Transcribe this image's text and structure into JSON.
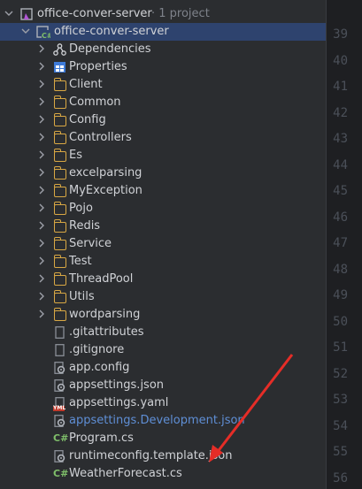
{
  "root": {
    "label": "office-conver-server",
    "suffix": "· 1 project"
  },
  "project": {
    "label": "office-conver-server"
  },
  "items": [
    {
      "label": "Dependencies",
      "icon": "dependencies-icon"
    },
    {
      "label": "Properties",
      "icon": "properties-icon"
    },
    {
      "label": "Client",
      "icon": "folder-icon"
    },
    {
      "label": "Common",
      "icon": "folder-icon"
    },
    {
      "label": "Config",
      "icon": "folder-icon"
    },
    {
      "label": "Controllers",
      "icon": "folder-icon"
    },
    {
      "label": "Es",
      "icon": "folder-icon"
    },
    {
      "label": "excelparsing",
      "icon": "folder-icon"
    },
    {
      "label": "MyException",
      "icon": "folder-icon"
    },
    {
      "label": "Pojo",
      "icon": "folder-icon"
    },
    {
      "label": "Redis",
      "icon": "folder-icon"
    },
    {
      "label": "Service",
      "icon": "folder-icon"
    },
    {
      "label": "Test",
      "icon": "folder-icon"
    },
    {
      "label": "ThreadPool",
      "icon": "folder-icon"
    },
    {
      "label": "Utils",
      "icon": "folder-icon"
    },
    {
      "label": "wordparsing",
      "icon": "folder-icon"
    }
  ],
  "files": [
    {
      "label": ".gitattributes",
      "icon": "file-icon"
    },
    {
      "label": ".gitignore",
      "icon": "file-icon"
    },
    {
      "label": "app.config",
      "icon": "config-file-icon"
    },
    {
      "label": "appsettings.json",
      "icon": "config-file-icon"
    },
    {
      "label": "appsettings.yaml",
      "icon": "yaml-file-icon",
      "badge": "YML"
    },
    {
      "label": "appsettings.Development.json",
      "icon": "config-file-icon"
    },
    {
      "label": "Program.cs",
      "icon": "csharp-file-icon",
      "badge": "C#"
    },
    {
      "label": "runtimeconfig.template.json",
      "icon": "config-file-icon"
    },
    {
      "label": "WeatherForecast.cs",
      "icon": "csharp-file-icon",
      "badge": "C#"
    }
  ],
  "project_badge": "C#",
  "line_numbers": [
    "39",
    "40",
    "41",
    "42",
    "43",
    "44",
    "45",
    "46",
    "47",
    "48",
    "49",
    "50",
    "51",
    "52",
    "53",
    "54",
    "55",
    "56"
  ],
  "colors": {
    "folder": "#d9a844",
    "selection": "#2e436e",
    "csharp": "#7fbf6a",
    "arrow": "#e52d27",
    "highlight_text": "#5f8fd6"
  }
}
